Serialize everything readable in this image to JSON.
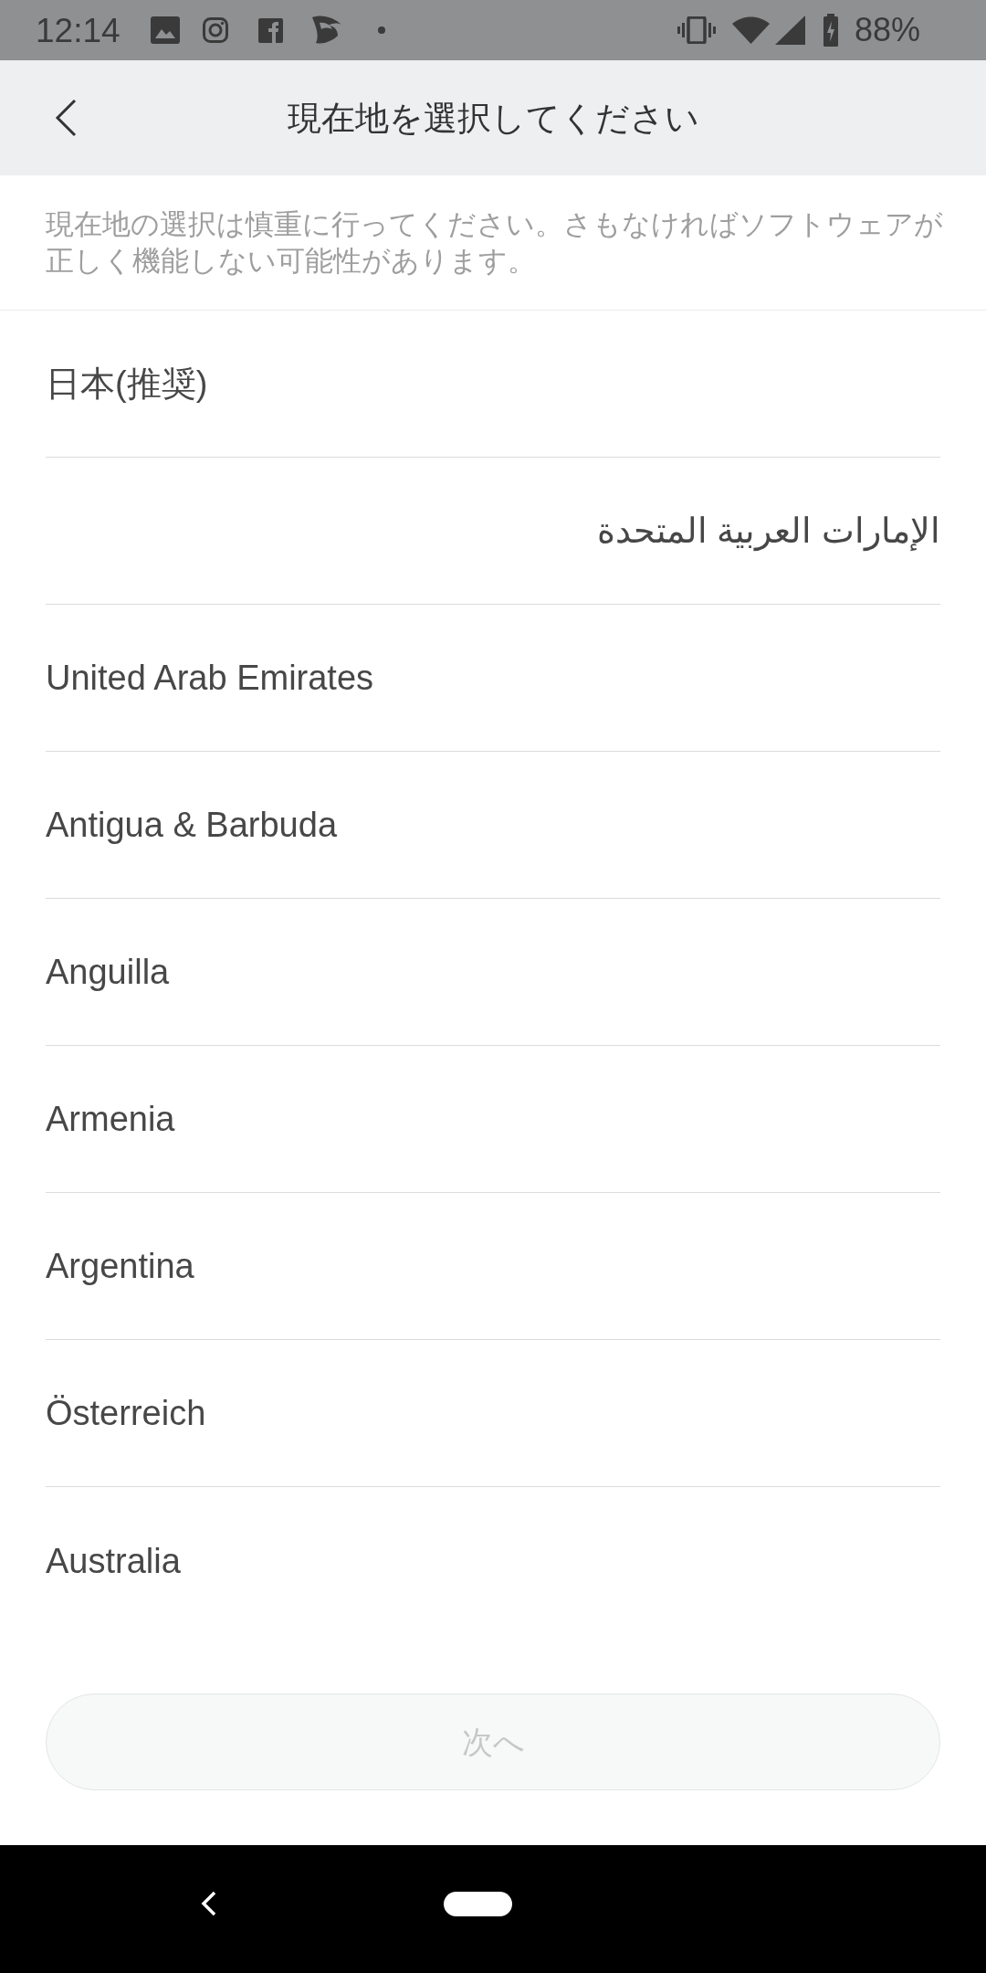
{
  "status_bar": {
    "time": "12:14",
    "battery": "88%"
  },
  "header": {
    "title": "現在地を選択してください"
  },
  "notice": "現在地の選択は慎重に行ってください。さもなければソフトウェアが正しく機能しない可能性があります。",
  "countries": [
    {
      "name": "日本(推奨)"
    },
    {
      "name": "الإمارات العربية المتحدة"
    },
    {
      "name": "United Arab Emirates"
    },
    {
      "name": "Antigua & Barbuda"
    },
    {
      "name": "Anguilla"
    },
    {
      "name": "Armenia"
    },
    {
      "name": "Argentina"
    },
    {
      "name": "Österreich"
    },
    {
      "name": "Australia"
    }
  ],
  "next_button": {
    "label": "次へ",
    "disabled": true
  }
}
